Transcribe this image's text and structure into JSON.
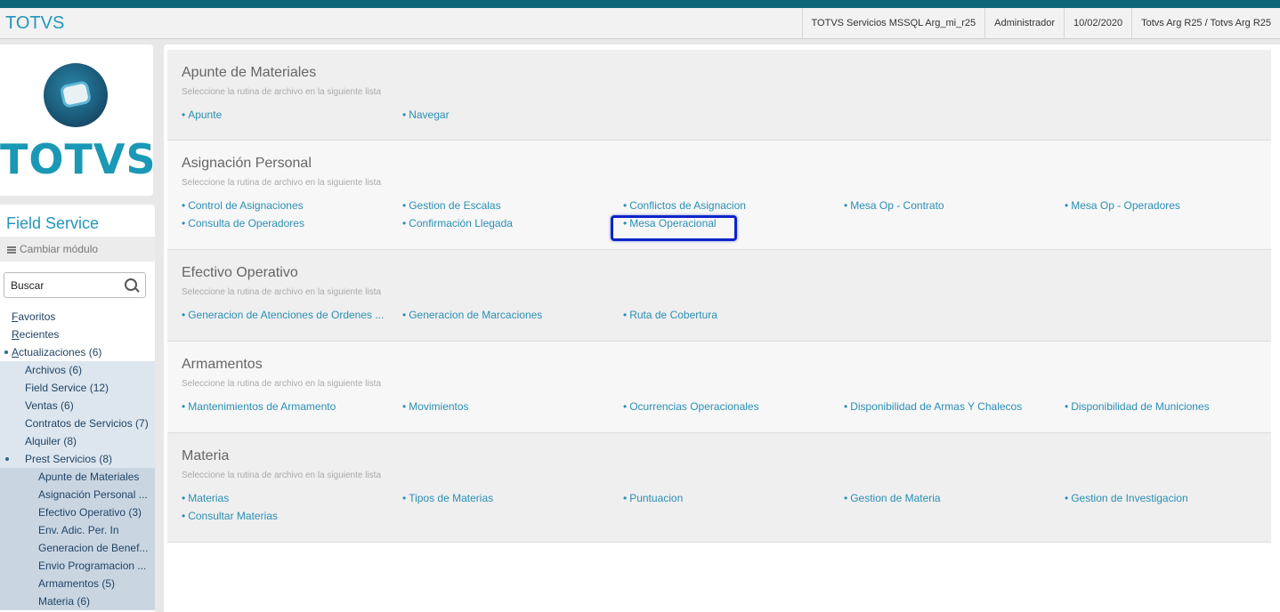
{
  "app": {
    "brand": "TOTVS"
  },
  "header": {
    "info": [
      "TOTVS Servicios MSSQL Arg_mi_r25",
      "Administrador",
      "10/02/2020",
      "Totvs Arg R25 / Totvs Arg R25"
    ]
  },
  "logo": {
    "text": "TOTVS"
  },
  "sidebar": {
    "module_title": "Field Service",
    "change_module": "Cambiar módulo",
    "search_placeholder": "Buscar",
    "tree": [
      {
        "label": "Favoritos",
        "level": 1
      },
      {
        "label": "Recientes",
        "level": 1
      },
      {
        "label": "Actualizaciones (6)",
        "level": 1,
        "expanded": true
      },
      {
        "label": "Archivos (6)",
        "level": 2
      },
      {
        "label": "Field Service (12)",
        "level": 2
      },
      {
        "label": "Ventas (6)",
        "level": 2
      },
      {
        "label": "Contratos de Servicios (7)",
        "level": 2
      },
      {
        "label": "Alquiler (8)",
        "level": 2
      },
      {
        "label": "Prest Servicios (8)",
        "level": 2,
        "expanded": true
      },
      {
        "label": "Apunte de Materiales",
        "level": 3
      },
      {
        "label": "Asignación Personal ...",
        "level": 3
      },
      {
        "label": "Efectivo Operativo (3)",
        "level": 3
      },
      {
        "label": "Env. Adic. Per. In",
        "level": 3
      },
      {
        "label": "Generacion de Benef...",
        "level": 3
      },
      {
        "label": "Envio Programacion ...",
        "level": 3
      },
      {
        "label": "Armamentos (5)",
        "level": 3
      },
      {
        "label": "Materia (6)",
        "level": 3
      }
    ]
  },
  "main": {
    "subtitle": "Seleccione la rutina de archivo en la siguiente lista",
    "sections": [
      {
        "title": "Apunte de Materiales",
        "links": [
          "Apunte",
          "Navegar"
        ]
      },
      {
        "title": "Asignación Personal",
        "links": [
          "Control de Asignaciones",
          "Gestion de Escalas",
          "Conflictos de Asignacion",
          "Mesa Op - Contrato",
          "Mesa Op - Operadores",
          "Consulta de Operadores",
          "Confirmación Llegada",
          "Mesa Operacional"
        ]
      },
      {
        "title": "Efectivo Operativo",
        "links": [
          "Generacion de Atenciones de Ordenes ...",
          "Generacion de Marcaciones",
          "Ruta de Cobertura"
        ]
      },
      {
        "title": "Armamentos",
        "links": [
          "Mantenimientos de Armamento",
          "Movimientos",
          "Ocurrencias Operacionales",
          "Disponibilidad de Armas Y Chalecos",
          "Disponibilidad de Municiones"
        ]
      },
      {
        "title": "Materia",
        "links": [
          "Materias",
          "Tipos de Materias",
          "Puntuacion",
          "Gestion de Materia",
          "Gestion de Investigacion",
          "Consultar Materias"
        ]
      }
    ],
    "highlighted_link": "Mesa Operacional"
  }
}
